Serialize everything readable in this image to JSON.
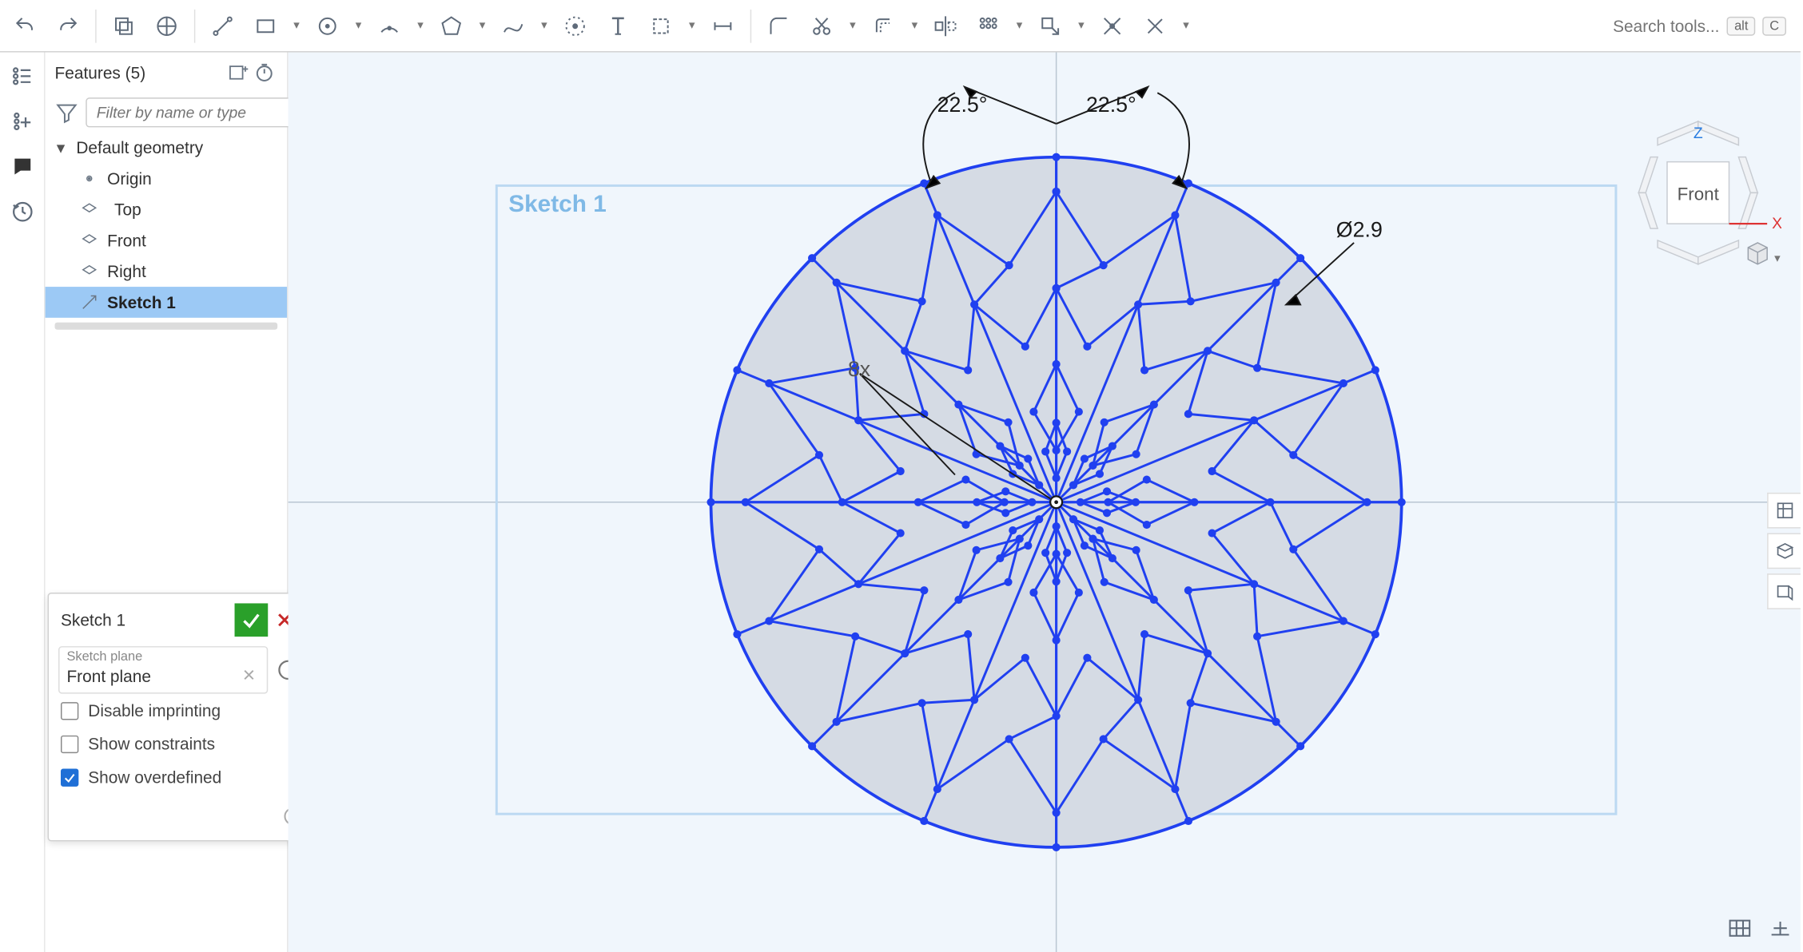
{
  "toolbar": {
    "search_placeholder": "Search tools...",
    "shortcut_hint1": "alt",
    "shortcut_hint2": "C"
  },
  "features": {
    "title": "Features (5)",
    "filter_placeholder": "Filter by name or type",
    "default_geometry": "Default geometry",
    "origin": "Origin",
    "top_plane": "Top",
    "front_plane": "Front",
    "right_plane": "Right",
    "sketch1": "Sketch 1"
  },
  "sketch_dialog": {
    "title": "Sketch 1",
    "plane_label": "Sketch plane",
    "plane_value": "Front plane",
    "disable_imprinting": "Disable imprinting",
    "show_constraints": "Show constraints",
    "show_overdefined": "Show overdefined"
  },
  "viewport": {
    "sketch_label": "Sketch 1",
    "angle_left": "22.5°",
    "angle_right": "22.5°",
    "diameter": "Ø2.9",
    "pattern_count": "8x"
  },
  "viewcube": {
    "face": "Front",
    "axis_z": "Z",
    "axis_x": "X"
  }
}
